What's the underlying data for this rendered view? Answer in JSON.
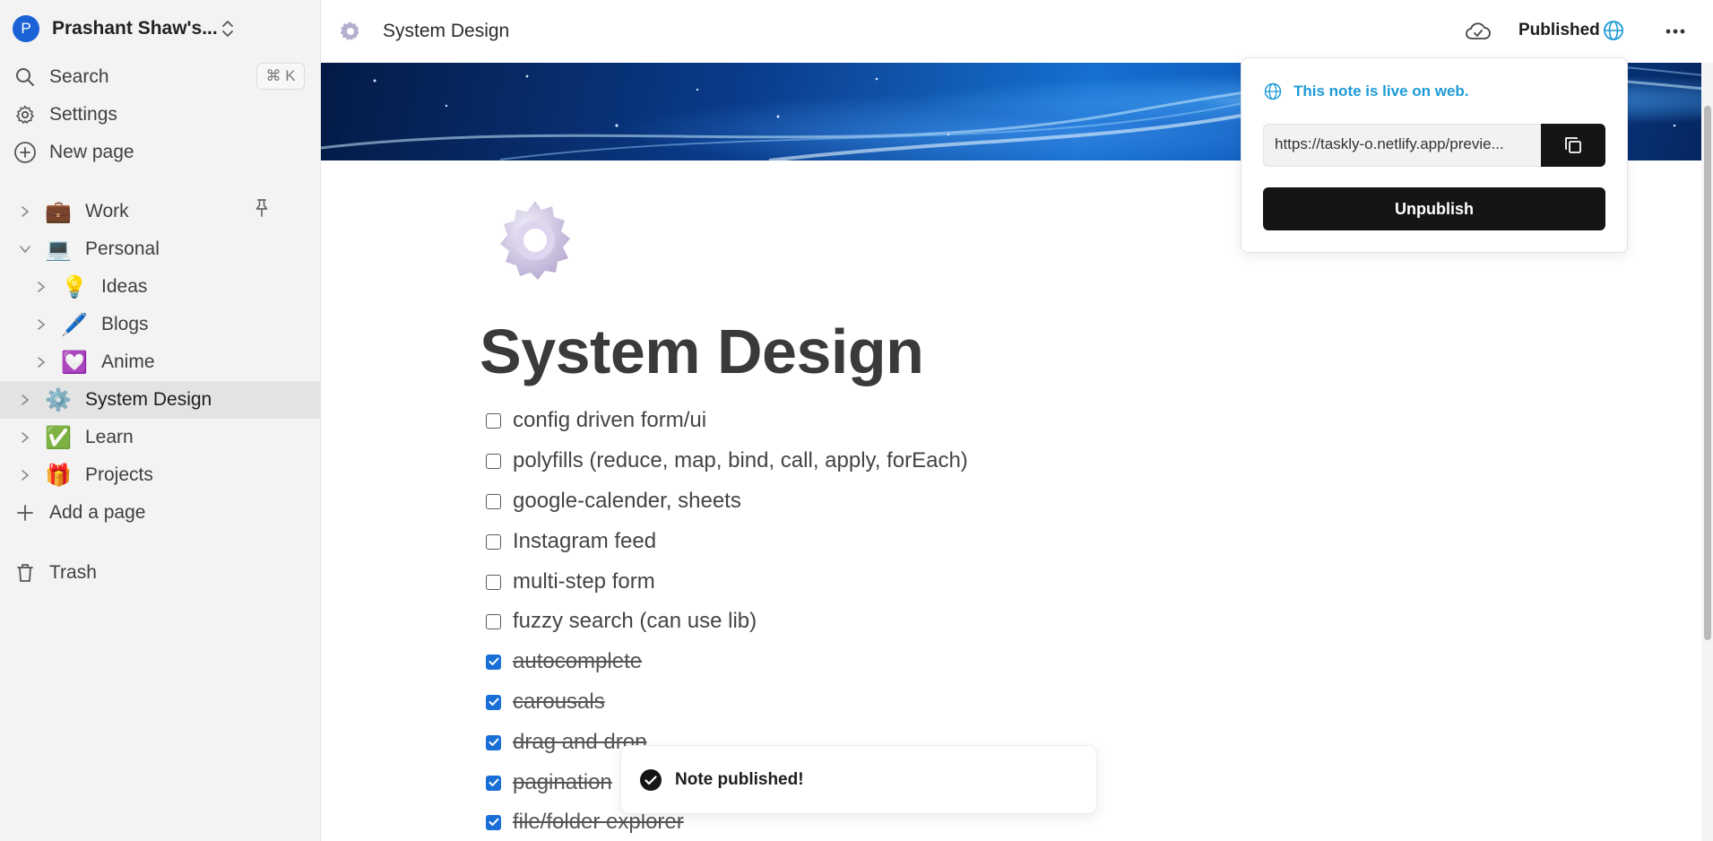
{
  "workspace": {
    "avatar_letter": "P",
    "name": "Prashant Shaw's..."
  },
  "sidebar": {
    "search_label": "Search",
    "search_shortcut": "⌘ K",
    "settings_label": "Settings",
    "new_page_label": "New page",
    "pages": [
      {
        "label": "Work",
        "emoji": "💼",
        "level": 0,
        "expanded": false
      },
      {
        "label": "Personal",
        "emoji": "💻",
        "level": 0,
        "expanded": true
      },
      {
        "label": "Ideas",
        "emoji": "💡",
        "level": 1,
        "expanded": false
      },
      {
        "label": "Blogs",
        "emoji": "🖊️",
        "level": 1,
        "expanded": false
      },
      {
        "label": "Anime",
        "emoji": "💟",
        "level": 1,
        "expanded": false
      },
      {
        "label": "System Design",
        "emoji": "⚙️",
        "level": 0,
        "expanded": false,
        "active": true
      },
      {
        "label": "Learn",
        "emoji": "✅",
        "level": 0,
        "expanded": false
      },
      {
        "label": "Projects",
        "emoji": "🎁",
        "level": 0,
        "expanded": false
      }
    ],
    "add_page_label": "Add a page",
    "trash_label": "Trash"
  },
  "header": {
    "breadcrumb_title": "System Design",
    "published_label": "Published"
  },
  "page": {
    "title": "System Design",
    "todos": [
      {
        "text": "config driven form/ui",
        "checked": false
      },
      {
        "text": "polyfills (reduce, map, bind, call, apply, forEach)",
        "checked": false
      },
      {
        "text": "google-calender, sheets",
        "checked": false
      },
      {
        "text": "Instagram feed",
        "checked": false
      },
      {
        "text": "multi-step form",
        "checked": false
      },
      {
        "text": "fuzzy search (can use lib)",
        "checked": false
      },
      {
        "text": "autocomplete",
        "checked": true
      },
      {
        "text": "carousals",
        "checked": true
      },
      {
        "text": "drag and drop",
        "checked": true
      },
      {
        "text": "pagination",
        "checked": true
      },
      {
        "text": "file/folder explorer",
        "checked": true
      }
    ]
  },
  "publish_popover": {
    "live_text": "This note is live on web.",
    "url": "https://taskly-o.netlify.app/previe...",
    "unpublish_label": "Unpublish"
  },
  "toast": {
    "message": "Note published!"
  },
  "colors": {
    "accent_blue": "#1d9bd6",
    "checkbox_blue": "#1a6fd6",
    "button_black": "#151515",
    "sidebar_bg": "#f3f3f3"
  }
}
